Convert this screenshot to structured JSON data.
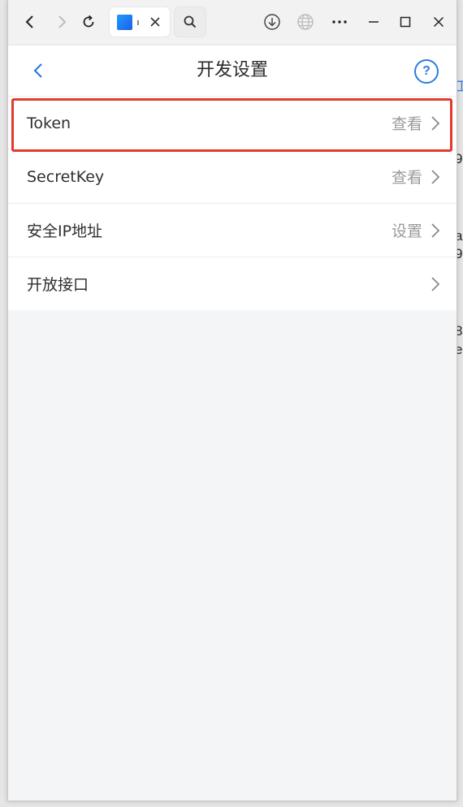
{
  "background_fragments": [
    "工",
    "9",
    "a",
    "9",
    "8",
    "e("
  ],
  "browser": {
    "tab_icon": "app-favicon",
    "tab_separator": ":",
    "icons": {
      "back": "chevron-left-icon",
      "forward": "chevron-right-icon",
      "reload": "reload-icon",
      "close_tab": "close-icon",
      "search": "search-icon",
      "download": "download-icon",
      "globe": "globe-icon",
      "more": "more-horizontal-icon",
      "minimize": "minimize-icon",
      "maximize": "maximize-icon",
      "close_window": "close-window-icon"
    }
  },
  "app": {
    "title": "开发设置",
    "help_label": "?",
    "accent_color": "#2d7be0",
    "highlight_color": "#e23a2e",
    "rows": [
      {
        "label": "Token",
        "action": "查看"
      },
      {
        "label": "SecretKey",
        "action": "查看"
      },
      {
        "label": "安全IP地址",
        "action": "设置"
      },
      {
        "label": "开放接口",
        "action": ""
      }
    ]
  }
}
